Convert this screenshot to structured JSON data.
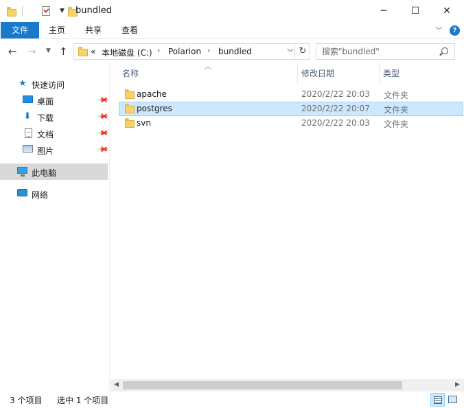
{
  "window": {
    "title": "bundled",
    "minimize_glyph": "─",
    "maximize_glyph": "☐",
    "close_glyph": "✕"
  },
  "ribbon": {
    "tabs": [
      {
        "label": "文件",
        "active": true
      },
      {
        "label": "主页"
      },
      {
        "label": "共享"
      },
      {
        "label": "查看"
      }
    ],
    "help_glyph": "?"
  },
  "nav": {
    "breadcrumb": [
      "本地磁盘 (C:)",
      "Polarion",
      "bundled"
    ],
    "overflow_glyph": "«",
    "search_placeholder": "搜索\"bundled\""
  },
  "sidebar": {
    "items": [
      {
        "label": "快速访问",
        "icon": "star-icon"
      },
      {
        "label": "桌面",
        "icon": "desktop-icon",
        "pinned": true
      },
      {
        "label": "下载",
        "icon": "download-icon",
        "pinned": true
      },
      {
        "label": "文档",
        "icon": "document-icon",
        "pinned": true
      },
      {
        "label": "图片",
        "icon": "pictures-icon",
        "pinned": true
      },
      {
        "label": "此电脑",
        "icon": "computer-icon",
        "selected": true
      },
      {
        "label": "网络",
        "icon": "network-icon"
      }
    ]
  },
  "columns": {
    "name": "名称",
    "date": "修改日期",
    "type": "类型"
  },
  "files": [
    {
      "name": "apache",
      "date": "2020/2/22 20:03",
      "type": "文件夹"
    },
    {
      "name": "postgres",
      "date": "2020/2/22 20:07",
      "type": "文件夹",
      "selected": true
    },
    {
      "name": "svn",
      "date": "2020/2/22 20:03",
      "type": "文件夹"
    }
  ],
  "status": {
    "item_count": "3 个项目",
    "selected_count": "选中 1 个项目"
  },
  "colors": {
    "accent": "#1979ca",
    "selection_bg": "#cce8ff",
    "selection_border": "#99d1ff",
    "folder": "#f6d46a"
  }
}
